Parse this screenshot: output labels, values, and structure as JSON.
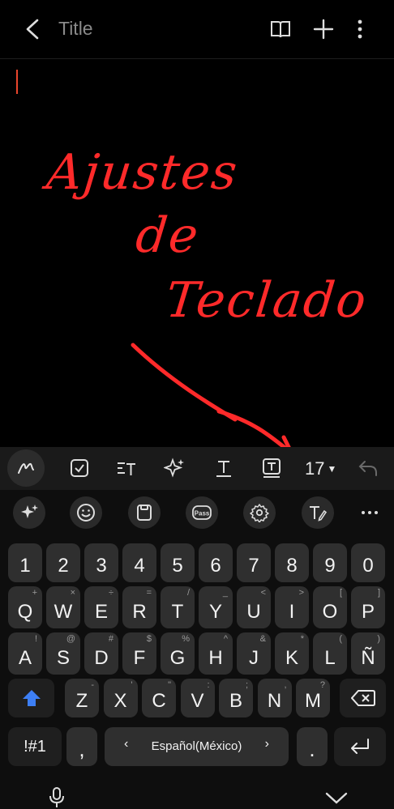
{
  "header": {
    "title": "Title"
  },
  "handwriting": {
    "line1": "Ajustes",
    "line2": "de",
    "line3": "Teclado"
  },
  "toolbar": {
    "font_size": "17"
  },
  "keyboard": {
    "row_numbers": [
      "1",
      "2",
      "3",
      "4",
      "5",
      "6",
      "7",
      "8",
      "9",
      "0"
    ],
    "row_q": [
      {
        "k": "Q",
        "s": "+"
      },
      {
        "k": "W",
        "s": "×"
      },
      {
        "k": "E",
        "s": "÷"
      },
      {
        "k": "R",
        "s": "="
      },
      {
        "k": "T",
        "s": "/"
      },
      {
        "k": "Y",
        "s": "_"
      },
      {
        "k": "U",
        "s": "<"
      },
      {
        "k": "I",
        "s": ">"
      },
      {
        "k": "O",
        "s": "["
      },
      {
        "k": "P",
        "s": "]"
      }
    ],
    "row_a": [
      {
        "k": "A",
        "s": "!"
      },
      {
        "k": "S",
        "s": "@"
      },
      {
        "k": "D",
        "s": "#"
      },
      {
        "k": "F",
        "s": "$"
      },
      {
        "k": "G",
        "s": "%"
      },
      {
        "k": "H",
        "s": "^"
      },
      {
        "k": "J",
        "s": "&"
      },
      {
        "k": "K",
        "s": "*"
      },
      {
        "k": "L",
        "s": "("
      },
      {
        "k": "Ñ",
        "s": ")"
      }
    ],
    "row_z": [
      {
        "k": "Z",
        "s": "-"
      },
      {
        "k": "X",
        "s": "'"
      },
      {
        "k": "C",
        "s": "\""
      },
      {
        "k": "V",
        "s": ":"
      },
      {
        "k": "B",
        "s": ";"
      },
      {
        "k": "N",
        "s": ","
      },
      {
        "k": "M",
        "s": "?"
      }
    ],
    "symbols_label": "!#1",
    "comma": ",",
    "space_label": "Español(México)",
    "period": "."
  }
}
